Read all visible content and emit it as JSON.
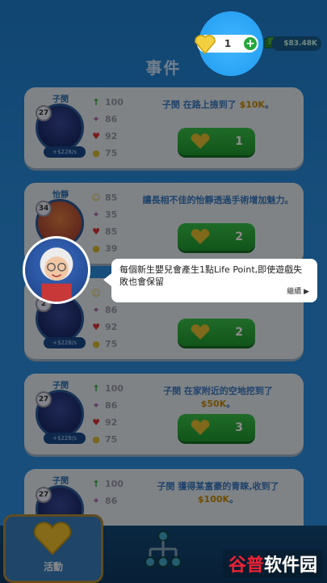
{
  "top": {
    "hearts_count": "1",
    "money": "$83.48K",
    "plus_label": "+"
  },
  "section_title": "事件",
  "cards": [
    {
      "name": "子閔",
      "age": "27",
      "income": "+$228/s",
      "stats": [
        "100",
        "86",
        "92",
        "75"
      ],
      "desc": "子閔 在路上撿到了",
      "amount": "$10K",
      "desc_tail": "。",
      "choice": "1"
    },
    {
      "name": "怡靜",
      "age": "34",
      "income": "",
      "stats": [
        "85",
        "35",
        "85",
        "39"
      ],
      "desc": "讓長相不佳的怡靜透過手術增加魅力。",
      "amount": "",
      "desc_tail": "",
      "choice": "2"
    },
    {
      "name": "",
      "age": "2",
      "income": "+$228/s",
      "stats": [
        "",
        "86",
        "92",
        "75"
      ],
      "desc": "",
      "amount": "",
      "desc_tail": "",
      "choice": "2"
    },
    {
      "name": "子閔",
      "age": "27",
      "income": "+$228/s",
      "stats": [
        "100",
        "86",
        "92",
        "75"
      ],
      "desc": "子閔 在家附近的空地挖到了",
      "amount": "$50K",
      "desc_tail": "。",
      "choice": "3"
    },
    {
      "name": "子閔",
      "age": "27",
      "income": "",
      "stats": [
        "100",
        "86",
        "",
        ""
      ],
      "desc": "子閔 獲得某富豪的青睞,收到了",
      "amount": "$100K",
      "desc_tail": "。",
      "choice": ""
    }
  ],
  "dialog": {
    "text": "每個新生嬰兒會產生1點Life Point,即使遊戲失敗也會保留",
    "continue": "繼續"
  },
  "nav": {
    "activity_label": "活動"
  },
  "watermark": {
    "w1": "谷普",
    "w2": "软件园"
  },
  "colors": {
    "accent_green": "#22a83a",
    "bg_blue": "#2a8fe0",
    "gold": "#f2c230"
  }
}
